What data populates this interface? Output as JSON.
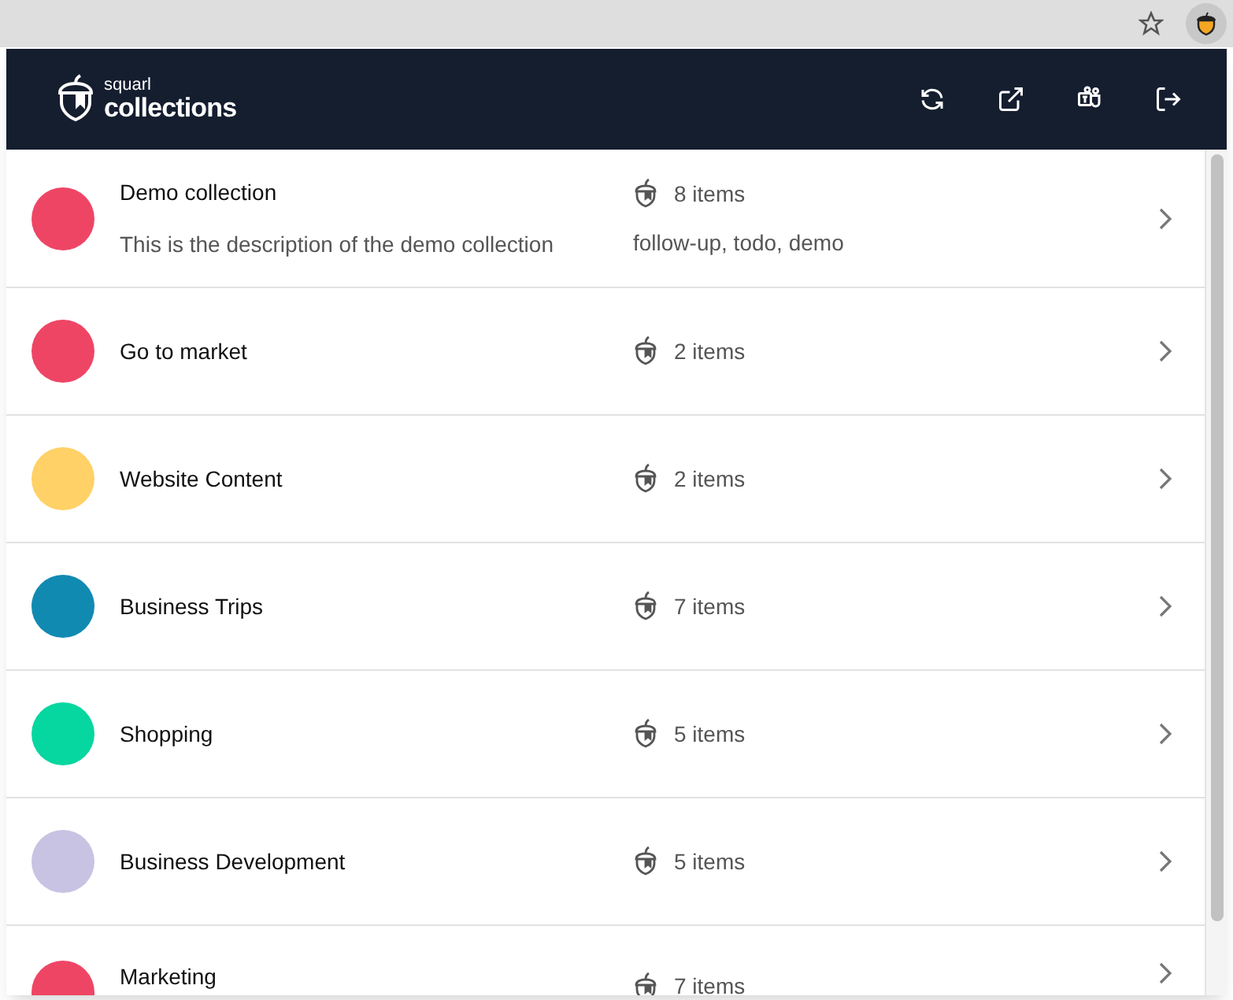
{
  "header": {
    "brand_small": "squarl",
    "brand_large": "collections"
  },
  "collections": [
    {
      "name": "Demo collection",
      "description": "This is the description of the demo collection",
      "count": "8 items",
      "tags": "follow-up, todo, demo",
      "color": "#ef4565"
    },
    {
      "name": "Go to market",
      "count": "2 items",
      "color": "#ef4565"
    },
    {
      "name": "Website Content",
      "count": "2 items",
      "color": "#ffd166"
    },
    {
      "name": "Business Trips",
      "count": "7 items",
      "color": "#118ab2"
    },
    {
      "name": "Shopping",
      "count": "5 items",
      "color": "#06d6a0"
    },
    {
      "name": "Business Development",
      "count": "5 items",
      "color": "#c8c3e3"
    },
    {
      "name": "Marketing",
      "count": "7 items",
      "color": "#ef4565"
    }
  ]
}
